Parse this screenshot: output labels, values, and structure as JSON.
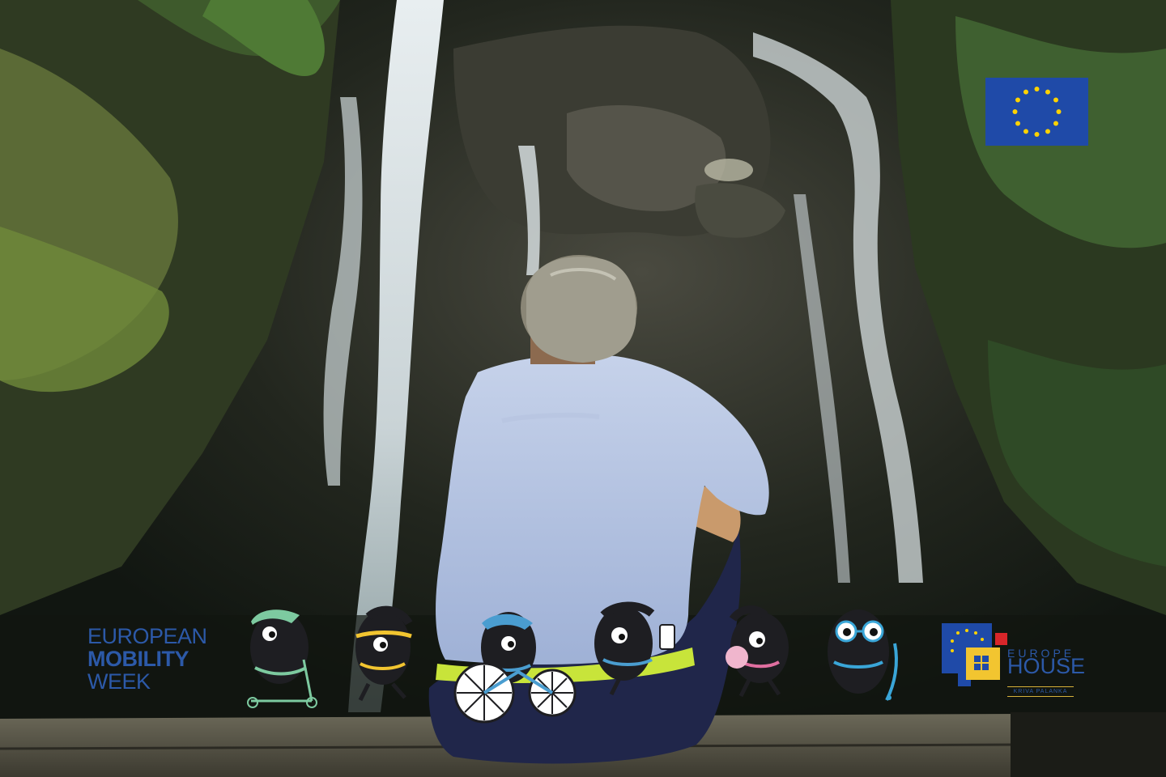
{
  "photo": {
    "description_icon": "waterfall-photo"
  },
  "logos": {
    "emw": {
      "line1": "EUROPEAN",
      "line2": "MOBILITY",
      "line3": "WEEK",
      "color": "#2c59a8"
    },
    "europe_house": {
      "line1": "EUROPE",
      "line2": "HOUSE",
      "line3": "KRIVA PALANKA",
      "color": "#2c59a8"
    },
    "eu_flag": {
      "icon": "eu-flag-icon",
      "color": "#1f4aa8",
      "star_color": "#ffd200"
    }
  },
  "mascots": [
    {
      "icon": "scooter-mascot-icon",
      "accent": "#7dcaa0"
    },
    {
      "icon": "running-mascot-icon",
      "accent": "#f2c530"
    },
    {
      "icon": "bicycle-mascot-icon",
      "accent": "#4a9dd0"
    },
    {
      "icon": "phone-mascot-icon",
      "accent": "#4a9dd0"
    },
    {
      "icon": "ball-mascot-icon",
      "accent": "#e06fa0"
    },
    {
      "icon": "skateboard-mascot-icon",
      "accent": "#3aa6d8"
    }
  ]
}
